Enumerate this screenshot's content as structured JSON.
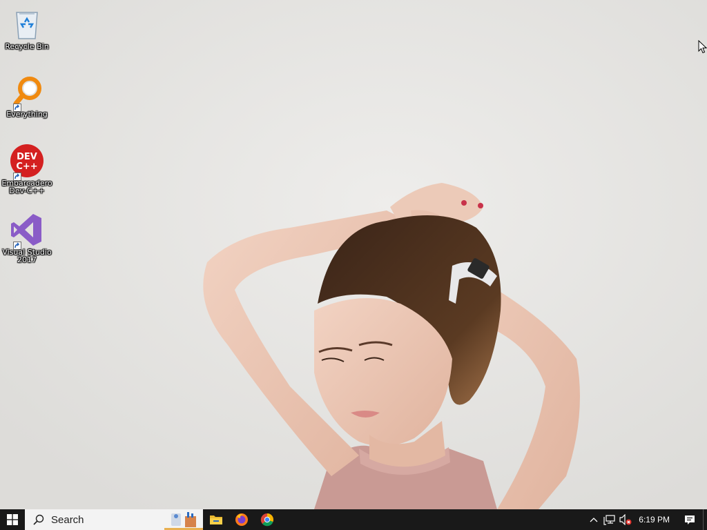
{
  "desktop": {
    "icons": [
      {
        "label": "Recycle Bin",
        "icon": "recycle-bin-icon"
      },
      {
        "label": "Everything",
        "icon": "everything-search-icon"
      },
      {
        "label": "Embarcadero Dev-C++",
        "icon": "devcpp-icon",
        "logo_text": "DEV C++"
      },
      {
        "label": "Visual Studio 2017",
        "icon": "visual-studio-icon"
      }
    ]
  },
  "taskbar": {
    "search_placeholder": "Search",
    "apps": [
      "file-explorer-icon",
      "firefox-icon",
      "chrome-icon"
    ],
    "clock": "6:19 PM",
    "tray_icons": [
      "chevron-up-icon",
      "network-icon",
      "volume-muted-icon",
      "action-center-icon"
    ],
    "background": "#191919"
  }
}
